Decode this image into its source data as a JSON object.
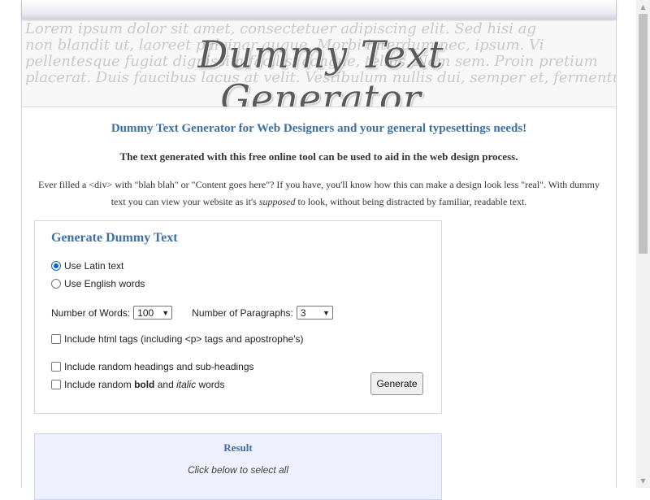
{
  "banner": {
    "logo_text": "Dummy Text Generator",
    "background_lines": [
      "Lorem ipsum dolor sit amet, consectetuer adipiscing elit. Sed hisi ag",
      "non blandit ut, laoreet pulvinar augue. Morbi interdum nec, ipsum. Vi",
      "pellentesque fugiat dignissim facilisi congue, tellus. Nam sem. Proin pretium",
      "placerat. Duis faucibus lacus at velit. Vestibulum nullis dui, semper et, fermentum"
    ]
  },
  "content": {
    "headline": "Dummy Text Generator for Web Designers and your general typesettings needs!",
    "subhead": "The text generated with this free online tool can be used to aid in the web design process.",
    "intro_part1": "Ever filled a <div> with \"blah blah\" or \"Content goes here\"? If you have, you'll know how this can make a design look less \"real\". With dummy text you can view your website as it's ",
    "intro_emph": "supposed",
    "intro_part2": " to look, without being distracted by familiar, readable text."
  },
  "generator": {
    "title": "Generate Dummy Text",
    "radio_latin": "Use Latin text",
    "radio_english": "Use English words",
    "words_label": "Number of Words:",
    "words_value": "100",
    "paragraphs_label": "Number of Paragraphs:",
    "paragraphs_value": "3",
    "check_html": "Include html tags (including <p> tags and apostrophe's)",
    "check_headings": "Include random headings and sub-headings",
    "check_bold_pre": "Include random ",
    "check_bold_word": "bold",
    "check_bold_mid": " and ",
    "check_italic_word": "italic",
    "check_bold_post": " words",
    "button_label": "Generate"
  },
  "result": {
    "title": "Result",
    "hint": "Click below to select all"
  },
  "icons": {
    "scroll_up": "triangle-up",
    "scroll_down": "triangle-down",
    "select_chevron": "chevron-down"
  }
}
